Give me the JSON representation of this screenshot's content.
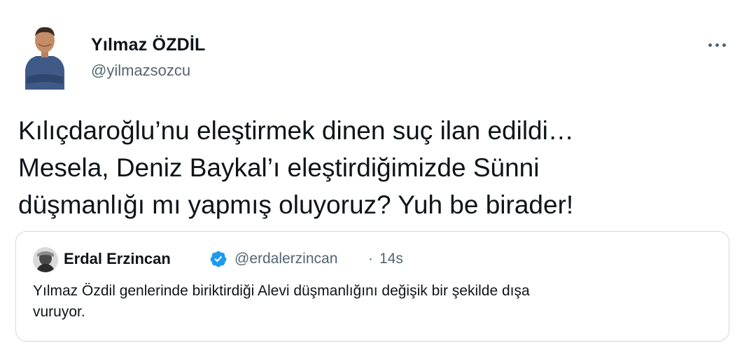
{
  "tweet": {
    "author": {
      "name": "Yılmaz ÖZDİL",
      "handle": "@yilmazsozcu",
      "avatar_icon": "person-avatar-icon"
    },
    "more_icon": "more-options-icon",
    "text_lines": [
      "Kılıçdaroğlu’nu eleştirmek dinen suç ilan edildi…",
      "Mesela, Deniz Baykal’ı eleştirdiğimizde Sünni",
      "düşmanlığı mı yapmış oluyoruz? Yuh be birader!"
    ]
  },
  "quoted_tweet": {
    "author": {
      "name": "Erdal Erzincan",
      "handle": "@erdalerzincan",
      "verified_icon": "verified-badge-icon",
      "avatar_icon": "person-avatar-icon"
    },
    "separator": "·",
    "time": "14s",
    "text_lines": [
      "Yılmaz Özdil genlerinde biriktirdiği Alevi düşmanlığını değişik bir şekilde dışa",
      "vuruyor."
    ]
  },
  "colors": {
    "text_primary": "#0f1419",
    "text_secondary": "#536471",
    "border": "#cfd9de",
    "verified_blue": "#1d9bf0"
  }
}
